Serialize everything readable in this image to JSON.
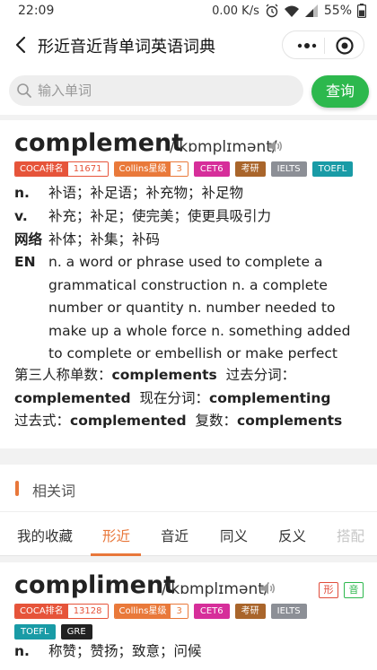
{
  "status_bar": {
    "time": "22:09",
    "net_speed": "0.00 K/s",
    "battery": "55%"
  },
  "nav": {
    "title": "形近音近背单词英语词典"
  },
  "search": {
    "placeholder": "输入单词",
    "button": "查询"
  },
  "main_word": {
    "word": "complement",
    "phonetic": "/'kɒmplɪmənt/",
    "tags": {
      "coca_label": "COCA排名",
      "coca_value": "11671",
      "collins_label": "Collins星级",
      "collins_value": "3",
      "cet6": "CET6",
      "kaoyan": "考研",
      "ielts": "IELTS",
      "toefl": "TOEFL"
    },
    "definitions": [
      {
        "pos": "n.",
        "text": "补语；补足语；补充物；补足物"
      },
      {
        "pos": "v.",
        "text": "补充；补足；使完美；使更具吸引力"
      },
      {
        "pos": "网络",
        "text": "补体；补集；补码"
      }
    ],
    "en_label": "EN",
    "en_text": "n. a word or phrase used to complete a grammatical construction n. a complete number or quantity n. number needed to make up a whole force n. something added to complete or embellish or make perfect",
    "forms": {
      "third_label": "第三人称单数：",
      "third_value": "complements",
      "past_part_label": "过去分词：",
      "past_part_value": "complemented",
      "present_part_label": "现在分词：",
      "present_part_value": "complementing",
      "past_label": "过去式：",
      "past_value": "complemented",
      "plural_label": "复数：",
      "plural_value": "complements"
    }
  },
  "related": {
    "heading": "相关词",
    "tabs": [
      "我的收藏",
      "形近",
      "音近",
      "同义",
      "反义",
      "搭配"
    ],
    "active_tab": "形近"
  },
  "related_word": {
    "word": "compliment",
    "phonetic": "/'kɒmplɪmənt/",
    "badges": [
      "形",
      "音"
    ],
    "tags": {
      "coca_label": "COCA排名",
      "coca_value": "13128",
      "collins_label": "Collins星级",
      "collins_value": "3",
      "cet6": "CET6",
      "kaoyan": "考研",
      "ielts": "IELTS",
      "toefl": "TOEFL",
      "gre": "GRE"
    },
    "definitions": [
      {
        "pos": "n.",
        "text": "称赞；赞扬；致意；问候"
      }
    ]
  },
  "colors": {
    "accent": "#e8773a",
    "primary_button": "#2db84d"
  }
}
